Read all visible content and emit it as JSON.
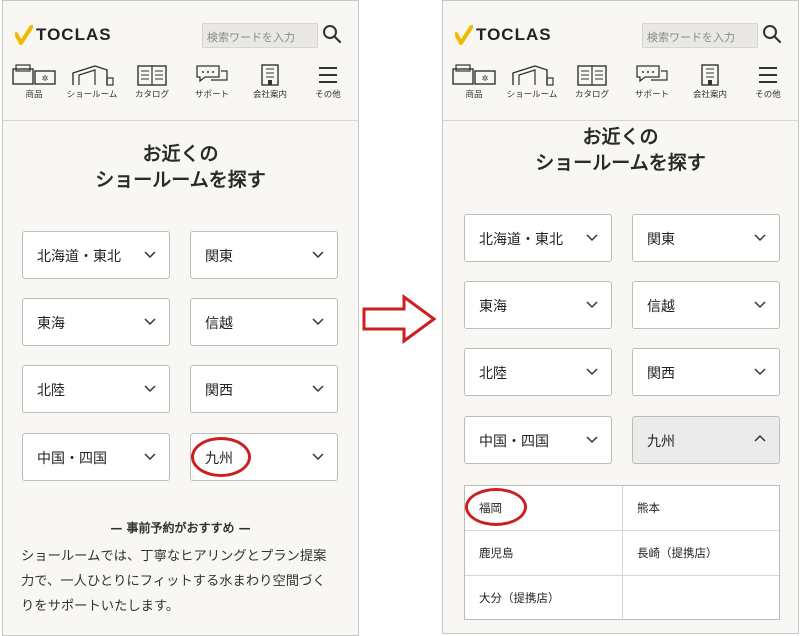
{
  "logo": {
    "text": "TOCLAS",
    "check_color": "#f2b900"
  },
  "search": {
    "placeholder": "検索ワードを入力"
  },
  "nav": [
    {
      "label": "商品",
      "icon": "product-icon"
    },
    {
      "label": "ショールーム",
      "icon": "showroom-icon"
    },
    {
      "label": "カタログ",
      "icon": "catalog-icon"
    },
    {
      "label": "サポート",
      "icon": "support-icon"
    },
    {
      "label": "会社案内",
      "icon": "company-icon"
    },
    {
      "label": "その他",
      "icon": "menu-icon"
    }
  ],
  "page_title": {
    "line1": "お近くの",
    "line2": "ショールームを探す"
  },
  "regions": [
    "北海道・東北",
    "関東",
    "東海",
    "信越",
    "北陸",
    "関西",
    "中国・四国",
    "九州"
  ],
  "promo": {
    "heading": "— 事前予約がおすすめ —",
    "lines": [
      "ショールームでは、丁寧なヒアリングとプラン提案",
      "力で、一人ひとりにフィットする水まわり空間づく",
      "りをサポートいたします。"
    ]
  },
  "kyushu_dropdown": [
    "福岡",
    "熊本",
    "鹿児島",
    "長崎（提携店）",
    "大分（提携店）",
    ""
  ],
  "colors": {
    "highlight_ring": "#cc1f1f",
    "accent": "#f2b900"
  }
}
